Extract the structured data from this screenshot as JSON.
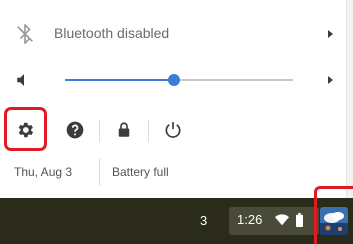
{
  "quick_settings": {
    "bluetooth": {
      "label": "Bluetooth disabled",
      "icon": "bluetooth-disabled-icon"
    },
    "volume": {
      "icon": "volume-icon",
      "level": 0.48
    },
    "buttons": [
      {
        "icon": "gear-icon",
        "name": "settings"
      },
      {
        "icon": "help-icon",
        "name": "help"
      },
      {
        "icon": "lock-icon",
        "name": "lock"
      },
      {
        "icon": "power-icon",
        "name": "power"
      }
    ],
    "date": "Thu, Aug 3",
    "battery_status": "Battery full"
  },
  "shelf": {
    "notification_count": "3",
    "time": "1:26",
    "wifi_icon": "wifi-icon",
    "battery_icon": "battery-icon"
  },
  "colors": {
    "accent": "#3f7bd8",
    "highlight": "#e01b24",
    "shelf_bg": "#2b2b1c",
    "status_bg": "#4a4a38"
  }
}
